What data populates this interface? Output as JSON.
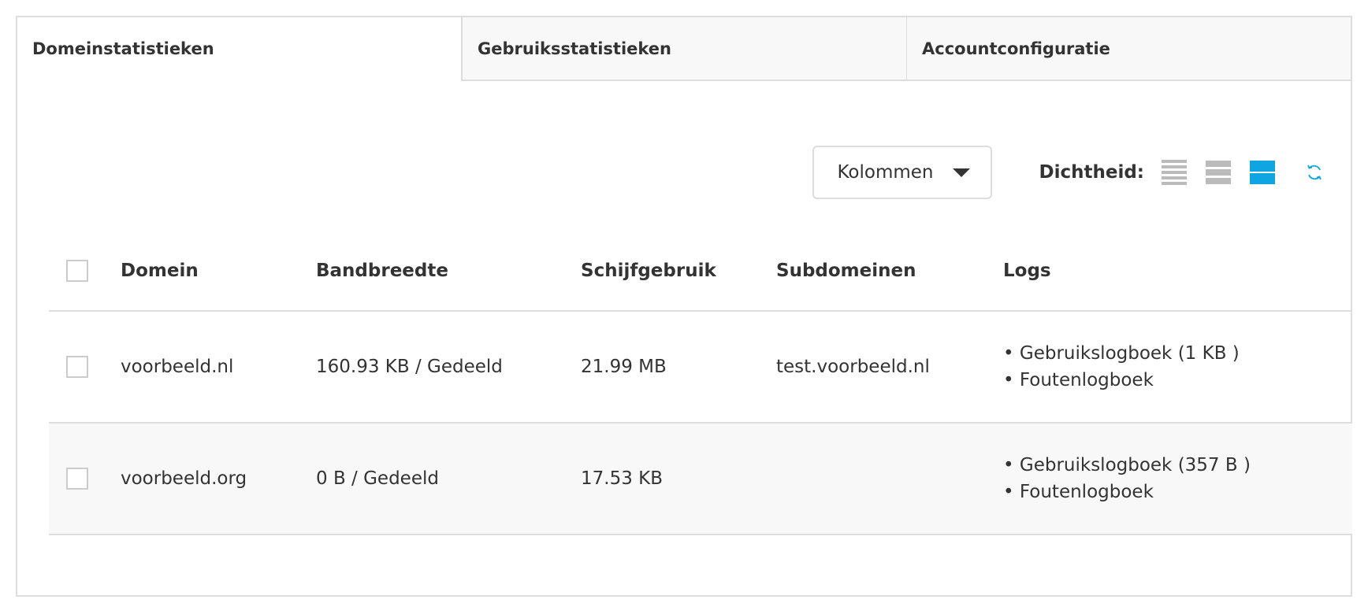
{
  "tabs": [
    {
      "label": "Domeinstatistieken",
      "active": true
    },
    {
      "label": "Gebruiksstatistieken",
      "active": false
    },
    {
      "label": "Accountconfiguratie",
      "active": false
    }
  ],
  "toolbar": {
    "columns_label": "Kolommen",
    "density_label": "Dichtheid:",
    "density_selected": "large",
    "accent_color": "#0ea5e0"
  },
  "table": {
    "headers": [
      "Domein",
      "Bandbreedte",
      "Schijfgebruik",
      "Subdomeinen",
      "Logs"
    ],
    "rows": [
      {
        "domain": "voorbeeld.nl",
        "bandwidth": "160.93 KB / Gedeeld",
        "disk": "21.99 MB",
        "subdomains": "test.voorbeeld.nl",
        "logs": [
          "• Gebruikslogboek (1 KB )",
          "• Foutenlogboek"
        ]
      },
      {
        "domain": "voorbeeld.org",
        "bandwidth": "0 B / Gedeeld",
        "disk": "17.53 KB",
        "subdomains": "",
        "logs": [
          "• Gebruikslogboek (357 B )",
          "• Foutenlogboek"
        ]
      }
    ]
  }
}
